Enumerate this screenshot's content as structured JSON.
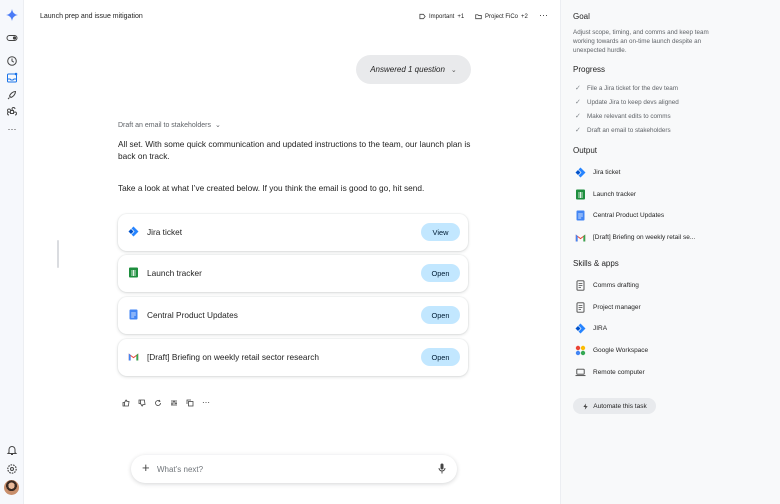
{
  "header": {
    "title": "Launch prep and issue mitigation",
    "chips": [
      {
        "label": "Important",
        "count": "+1",
        "icon": "label-icon"
      },
      {
        "label": "Project FiCo",
        "count": "+2",
        "icon": "folder-icon"
      }
    ],
    "more": "⋯"
  },
  "answered": {
    "label": "Answered 1 question",
    "icon": "chevron-down-icon"
  },
  "draft_header": {
    "label": "Draft an email to stakeholders",
    "icon": "chevron-down-icon"
  },
  "message": {
    "para1": "All set. With some quick communication and updated instructions to the team, our launch plan is back on track.",
    "para2": "Take a look at what I’ve created below. If you think the email is good to go, hit send."
  },
  "cards": [
    {
      "label": "Jira ticket",
      "button": "View",
      "icon": "jira-icon"
    },
    {
      "label": "Launch tracker",
      "button": "Open",
      "icon": "sheets-icon"
    },
    {
      "label": "Central Product Updates",
      "button": "Open",
      "icon": "docs-icon"
    },
    {
      "label": "[Draft] Briefing on weekly retail sector research",
      "button": "Open",
      "icon": "gmail-icon"
    }
  ],
  "response_actions": [
    "thumbs-up-icon",
    "thumbs-down-icon",
    "refresh-icon",
    "tune-icon",
    "copy-icon",
    "more-icon"
  ],
  "composer": {
    "placeholder": "What’s next?",
    "plus_icon": "plus-icon",
    "mic_icon": "mic-icon"
  },
  "sidebar": {
    "goal_title": "Goal",
    "goal_text": "Adjust scope, timing, and comms and keep team working towards an on-time launch despite an unexpected hurdle.",
    "progress_title": "Progress",
    "progress": [
      "File a Jira ticket for the dev team",
      "Update Jira to keep devs aligned",
      "Make relevant edits to comms",
      "Draft an email to stakeholders"
    ],
    "output_title": "Output",
    "output": [
      {
        "label": "Jira ticket",
        "icon": "jira-icon"
      },
      {
        "label": "Launch tracker",
        "icon": "sheets-icon"
      },
      {
        "label": "Central Product Updates",
        "icon": "docs-icon"
      },
      {
        "label": "[Draft] Briefing on weekly retail se...",
        "icon": "gmail-icon"
      }
    ],
    "skills_title": "Skills & apps",
    "skills": [
      {
        "label": "Comms drafting",
        "icon": "skill-doc-icon"
      },
      {
        "label": "Project manager",
        "icon": "skill-doc-icon"
      },
      {
        "label": "JIRA",
        "icon": "jira-icon"
      },
      {
        "label": "Google Workspace",
        "icon": "workspace-icon"
      },
      {
        "label": "Remote computer",
        "icon": "laptop-icon"
      }
    ],
    "automate": "Automate this task"
  },
  "colors": {
    "accent_button": "#c2e7ff",
    "chip_bg": "#e9eaec",
    "side_bg": "#f8f9fa"
  }
}
